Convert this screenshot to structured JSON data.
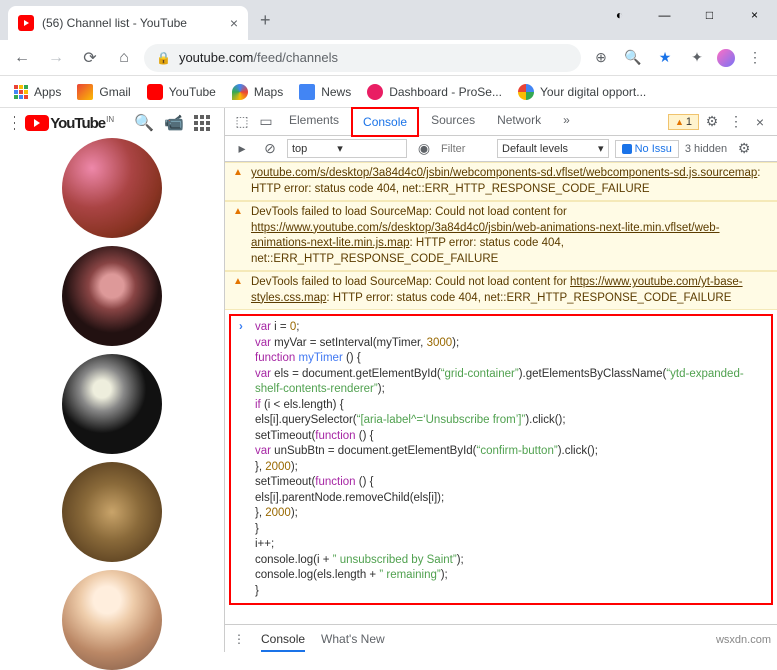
{
  "tab": {
    "title": "(56) Channel list - YouTube"
  },
  "url": {
    "host": "youtube.com",
    "path": "/feed/channels"
  },
  "bookmarks": [
    "Apps",
    "Gmail",
    "YouTube",
    "Maps",
    "News",
    "Dashboard - ProSe...",
    "Your digital opport..."
  ],
  "yt": {
    "brand": "YouTube",
    "region": "IN"
  },
  "devtools": {
    "tabs": [
      "Elements",
      "Console",
      "Sources",
      "Network"
    ],
    "active_tab": "Console",
    "warn_count": "1",
    "filter": {
      "context": "top",
      "placeholder": "Filter",
      "levels": "Default levels",
      "issues": "No Issu",
      "hidden": "3 hidden"
    },
    "warnings": [
      {
        "pre": "",
        "link": "youtube.com/s/desktop/3a84d4c0/jsbin/webcomponents-sd.vflset/webcomponents-sd.js.sourcemap",
        "post": ": HTTP error: status code 404, net::ERR_HTTP_RESPONSE_CODE_FAILURE"
      },
      {
        "pre": "DevTools failed to load SourceMap: Could not load content for ",
        "link": "https://www.youtube.com/s/desktop/3a84d4c0/jsbin/web-animations-next-lite.min.vflset/web-animations-next-lite.min.js.map",
        "post": ": HTTP error: status code 404, net::ERR_HTTP_RESPONSE_CODE_FAILURE"
      },
      {
        "pre": "DevTools failed to load SourceMap: Could not load content for ",
        "link": "https://www.youtube.com/yt-base-styles.css.map",
        "post": ": HTTP error: status code 404, net::ERR_HTTP_RESPONSE_CODE_FAILURE"
      }
    ],
    "code": [
      {
        "t": "var ",
        "c": "kw"
      },
      {
        "t": "i = "
      },
      {
        "t": "0",
        "c": "num"
      },
      {
        "t": ";\n"
      },
      {
        "t": "var ",
        "c": "kw"
      },
      {
        "t": "myVar = setInterval(myTimer, "
      },
      {
        "t": "3000",
        "c": "num"
      },
      {
        "t": ");\n"
      },
      {
        "t": "function ",
        "c": "kw"
      },
      {
        "t": "myTimer ",
        "c": "fn"
      },
      {
        "t": "() {\n"
      },
      {
        "t": "var ",
        "c": "kw"
      },
      {
        "t": "els = document.getElementById("
      },
      {
        "t": "“grid-container”",
        "c": "str"
      },
      {
        "t": ").getElementsByClassName("
      },
      {
        "t": "“ytd-expanded-shelf-contents-renderer”",
        "c": "str"
      },
      {
        "t": ");\n"
      },
      {
        "t": "if ",
        "c": "kw"
      },
      {
        "t": "(i < els.length) {\n"
      },
      {
        "t": "els[i].querySelector("
      },
      {
        "t": "“[aria-label^=‘Unsubscribe from’]”",
        "c": "str"
      },
      {
        "t": ").click();\n"
      },
      {
        "t": "setTimeout("
      },
      {
        "t": "function ",
        "c": "kw"
      },
      {
        "t": "() {\n"
      },
      {
        "t": "var ",
        "c": "kw"
      },
      {
        "t": "unSubBtn = document.getElementById("
      },
      {
        "t": "“confirm-button”",
        "c": "str"
      },
      {
        "t": ").click();\n"
      },
      {
        "t": "}, "
      },
      {
        "t": "2000",
        "c": "num"
      },
      {
        "t": ");\n"
      },
      {
        "t": "setTimeout("
      },
      {
        "t": "function ",
        "c": "kw"
      },
      {
        "t": "() {\n"
      },
      {
        "t": "els[i].parentNode.removeChild(els[i]);\n"
      },
      {
        "t": "}, "
      },
      {
        "t": "2000",
        "c": "num"
      },
      {
        "t": ");\n"
      },
      {
        "t": "}\n"
      },
      {
        "t": "i++;\n"
      },
      {
        "t": "console.log(i + "
      },
      {
        "t": "” unsubscribed by Saint”",
        "c": "str"
      },
      {
        "t": ");\n"
      },
      {
        "t": "console.log(els.length + "
      },
      {
        "t": "” remaining”",
        "c": "str"
      },
      {
        "t": ");\n"
      },
      {
        "t": "}"
      }
    ],
    "drawer": [
      "Console",
      "What's New"
    ]
  },
  "watermark": "wsxdn.com"
}
